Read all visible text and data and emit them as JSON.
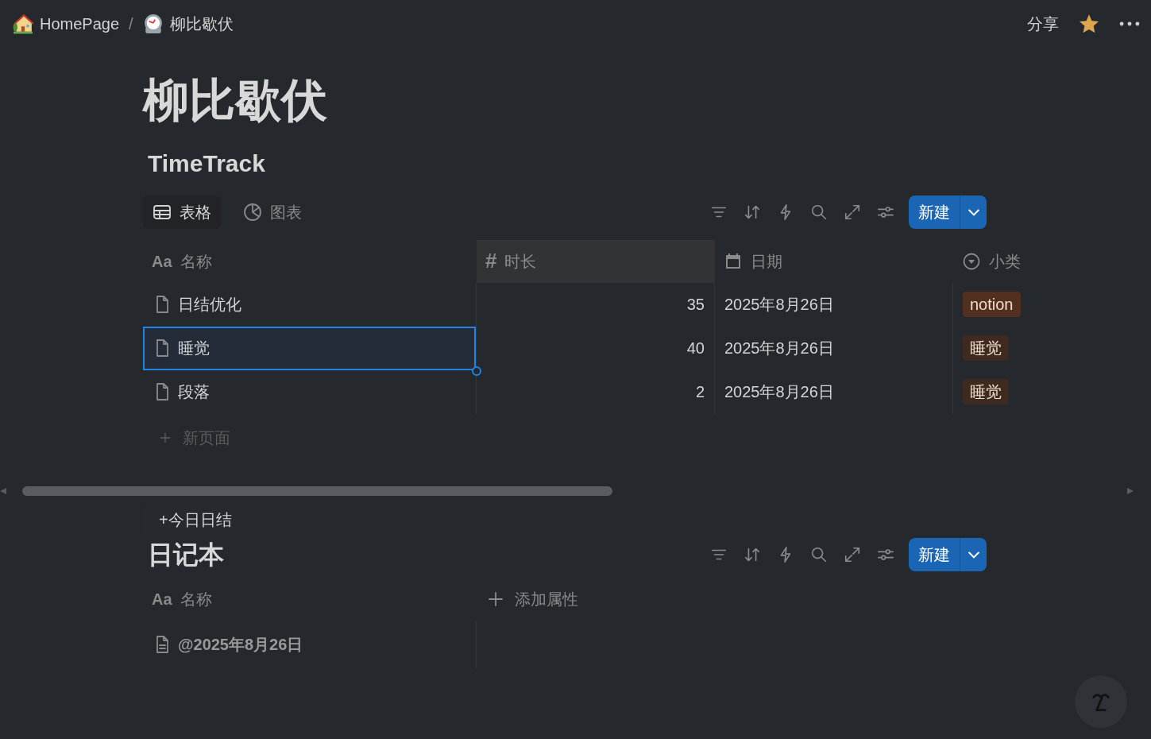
{
  "breadcrumb": [
    {
      "label": "HomePage"
    },
    {
      "label": "柳比歇伏"
    }
  ],
  "breadcrumb_separator": "/",
  "topbar": {
    "share": "分享",
    "favorite": true
  },
  "page_title": "柳比歇伏",
  "timetrack": {
    "title": "TimeTrack",
    "views": [
      {
        "label": "表格",
        "kind": "table",
        "selected": true
      },
      {
        "label": "图表",
        "kind": "chart",
        "selected": false
      }
    ],
    "new_button": "新建",
    "columns": [
      {
        "kind": "title",
        "type_mark": "Aa",
        "label": "名称",
        "highlighted": false
      },
      {
        "kind": "number",
        "type_mark": "#",
        "label": "时长",
        "highlighted": true
      },
      {
        "kind": "date",
        "label": "日期",
        "highlighted": false
      },
      {
        "kind": "select",
        "label": "小类",
        "highlighted": false
      }
    ],
    "rows": [
      {
        "name": "日结优化",
        "duration": "35",
        "date": "2025年8月26日",
        "tag": {
          "label": "notion",
          "color": "#522f1e"
        },
        "selected": false
      },
      {
        "name": "睡觉",
        "duration": "40",
        "date": "2025年8月26日",
        "tag": {
          "label": "睡觉",
          "color": "#3e2a1f"
        },
        "selected": true
      },
      {
        "name": "段落",
        "duration": "2",
        "date": "2025年8月26日",
        "tag": {
          "label": "睡觉",
          "color": "#3e2a1f"
        },
        "selected": false
      }
    ],
    "new_page": "新页面"
  },
  "action_button": "+今日日结",
  "journal": {
    "title": "日记本",
    "new_button": "新建",
    "columns": [
      {
        "kind": "title",
        "type_mark": "Aa",
        "label": "名称"
      }
    ],
    "add_property": "添加属性",
    "rows": [
      {
        "name": "@2025年8月26日"
      }
    ]
  }
}
